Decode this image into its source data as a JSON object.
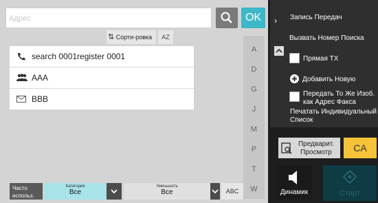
{
  "search": {
    "placeholder": "Адрес",
    "ok_label": "OK"
  },
  "sort": {
    "label": "Сорти-ровка",
    "az_label": "AZ"
  },
  "list": {
    "items": [
      {
        "label": "search 0001register 0001",
        "icon": "phone-icon"
      },
      {
        "label": "AAA",
        "icon": "group-icon"
      },
      {
        "label": "BBB",
        "icon": "email-icon"
      }
    ]
  },
  "alphabet": {
    "letters": [
      "A",
      "D",
      "G",
      "J",
      "M",
      "P",
      "T",
      "W"
    ],
    "abc_label": "ABC"
  },
  "bottom": {
    "frequent_label": "Часто использ.",
    "category_label": "Категория",
    "category_value": "Все",
    "reduce_label": "Уменьшить",
    "reduce_value": "Все"
  },
  "menu": {
    "items": [
      "Запись Передач",
      "Вызвать Номер Поиска",
      "Прямая ТХ",
      "Добавить Новую",
      "Передать То Же Изоб. как Адрес Факса",
      "Печатать Индивидуальный Список"
    ]
  },
  "actions": {
    "preview_label": "Предварит. Просмотр",
    "ca_label": "CA",
    "speaker_label": "Динамик",
    "start_label": "Старт"
  },
  "colors": {
    "accent": "#3db8c8",
    "ca": "#f5c23a",
    "start": "#0f3b45"
  }
}
